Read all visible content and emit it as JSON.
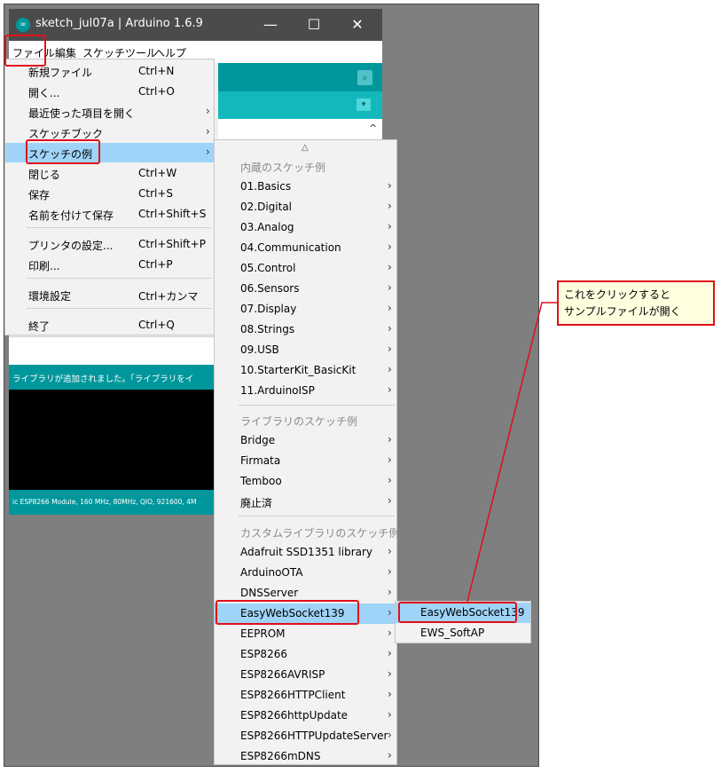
{
  "window": {
    "title": "sketch_jul07a | Arduino 1.6.9",
    "app_icon": "∞",
    "min": "—",
    "max": "☐",
    "close": "✕"
  },
  "menubar": {
    "file": "ファイル",
    "edit": "編集",
    "sketch": "スケッチ",
    "tools": "ツール",
    "help": "ヘルプ"
  },
  "file_menu": [
    {
      "label": "新規ファイル",
      "shortcut": "Ctrl+N",
      "arrow": ""
    },
    {
      "label": "開く...",
      "shortcut": "Ctrl+O",
      "arrow": ""
    },
    {
      "label": "最近使った項目を開く",
      "shortcut": "",
      "arrow": "›"
    },
    {
      "label": "スケッチブック",
      "shortcut": "",
      "arrow": "›"
    },
    {
      "label": "スケッチの例",
      "shortcut": "",
      "arrow": "›"
    },
    {
      "label": "閉じる",
      "shortcut": "Ctrl+W",
      "arrow": ""
    },
    {
      "label": "保存",
      "shortcut": "Ctrl+S",
      "arrow": ""
    },
    {
      "label": "名前を付けて保存",
      "shortcut": "Ctrl+Shift+S",
      "arrow": ""
    },
    {
      "label": "プリンタの設定...",
      "shortcut": "Ctrl+Shift+P",
      "arrow": ""
    },
    {
      "label": "印刷...",
      "shortcut": "Ctrl+P",
      "arrow": ""
    },
    {
      "label": "環境設定",
      "shortcut": "Ctrl+カンマ",
      "arrow": ""
    },
    {
      "label": "終了",
      "shortcut": "Ctrl+Q",
      "arrow": ""
    }
  ],
  "examples_menu": {
    "scroll_up": "△",
    "arrow": "›",
    "builtin_header": "内蔵のスケッチ例",
    "builtin": [
      "01.Basics",
      "02.Digital",
      "03.Analog",
      "04.Communication",
      "05.Control",
      "06.Sensors",
      "07.Display",
      "08.Strings",
      "09.USB",
      "10.StarterKit_BasicKit",
      "11.ArduinoISP"
    ],
    "library_header": "ライブラリのスケッチ例",
    "library": [
      "Bridge",
      "Firmata",
      "Temboo",
      "廃止済"
    ],
    "custom_header": "カスタムライブラリのスケッチ例",
    "custom": [
      "Adafruit SSD1351 library",
      "ArduinoOTA",
      "DNSServer",
      "EasyWebSocket139",
      "EEPROM",
      "ESP8266",
      "ESP8266AVRISP",
      "ESP8266HTTPClient",
      "ESP8266httpUpdate",
      "ESP8266HTTPUpdateServer",
      "ESP8266mDNS"
    ]
  },
  "ews_menu": [
    "EasyWebSocket139",
    "EWS_SoftAP"
  ],
  "status": {
    "message": "ライブラリが追加されました。「ライブラリをイ",
    "board": "ic ESP8266 Module, 160 MHz, 80MHz, QIO, 921600, 4M"
  },
  "toolbar": {
    "serial_icon": "⌕",
    "tab_dropdown": "▾",
    "scroll_up": "^"
  },
  "callout": {
    "line1": "これをクリックすると",
    "line2": "サンプルファイルが開く"
  },
  "colors": {
    "accent": "#00979c",
    "highlight": "#9fd3f7",
    "annotation": "#e0101a",
    "callout_bg": "#ffffe0"
  }
}
